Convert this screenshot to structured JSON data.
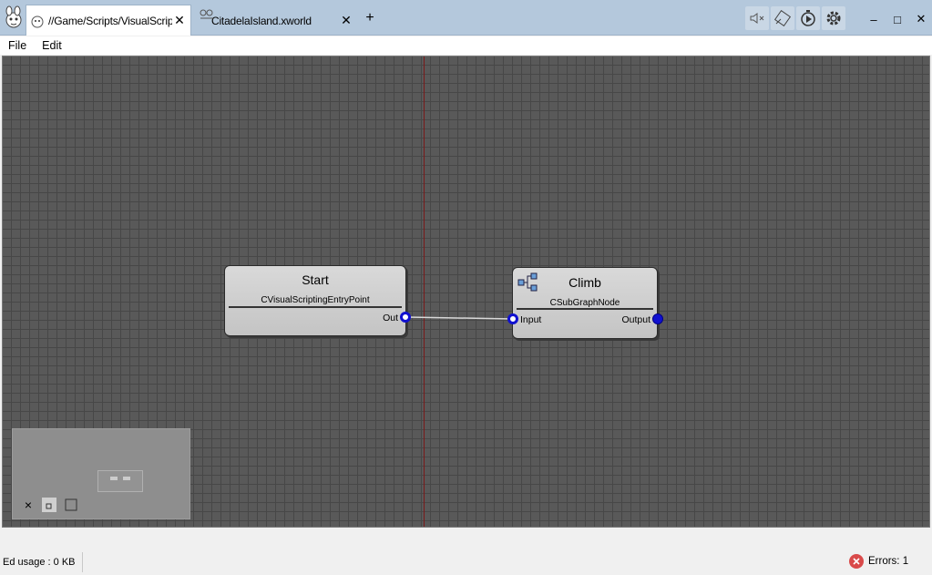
{
  "tabs": [
    {
      "label": "//Game/Scripts/VisualScripts/Climb",
      "close": "✕",
      "active": true
    },
    {
      "label": "CitadelaIsland.xworld",
      "close": "✕",
      "active": false
    }
  ],
  "new_tab": "+",
  "toolbar_icons": [
    "mute-icon",
    "screenshot-icon",
    "play-icon",
    "settings-icon"
  ],
  "window_controls": {
    "minimize": "–",
    "maximize": "□",
    "close": "✕"
  },
  "menu": [
    "File",
    "Edit"
  ],
  "nodes": {
    "start": {
      "title": "Start",
      "class": "CVisualScriptingEntryPoint",
      "out_label": "Out"
    },
    "climb": {
      "title": "Climb",
      "class": "CSubGraphNode",
      "input_label": "Input",
      "output_label": "Output"
    }
  },
  "minimap": {
    "close": "×"
  },
  "status": {
    "usage": "Ed usage : 0 KB",
    "errors": "Errors: 1"
  },
  "colors": {
    "canvas": "#595959",
    "grid": "#474747",
    "port": "#1010d0",
    "axis": "#7a1a1a",
    "tabbar": "#b4c8dc"
  }
}
